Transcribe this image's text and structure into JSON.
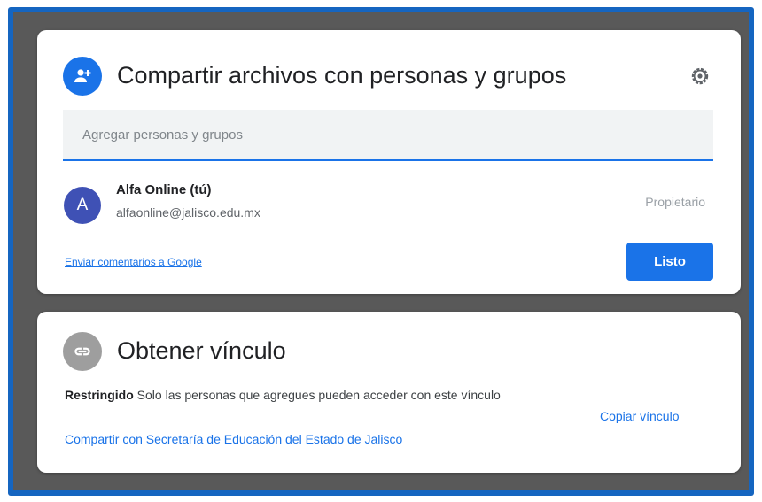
{
  "share_dialog": {
    "title": "Compartir archivos con personas y grupos",
    "add_people_placeholder": "Agregar personas y grupos",
    "person": {
      "avatar_letter": "A",
      "name": "Alfa Online (tú)",
      "email": "alfaonline@jalisco.edu.mx",
      "role": "Propietario"
    },
    "feedback_link": "Enviar comentarios a Google",
    "done_button": "Listo"
  },
  "link_dialog": {
    "title": "Obtener vínculo",
    "access_level": "Restringido",
    "access_description": "Solo las personas que agregues pueden acceder con este vínculo",
    "share_with_org": "Compartir con Secretaría de Educación del Estado de Jalisco",
    "copy_link": "Copiar vínculo"
  },
  "icons": {
    "share": "person-add-icon",
    "settings": "gear-icon",
    "link": "link-icon"
  },
  "colors": {
    "accent": "#1a73e8",
    "avatar": "#3f51b5",
    "frame": "#1565c0",
    "backdrop": "#595959"
  }
}
